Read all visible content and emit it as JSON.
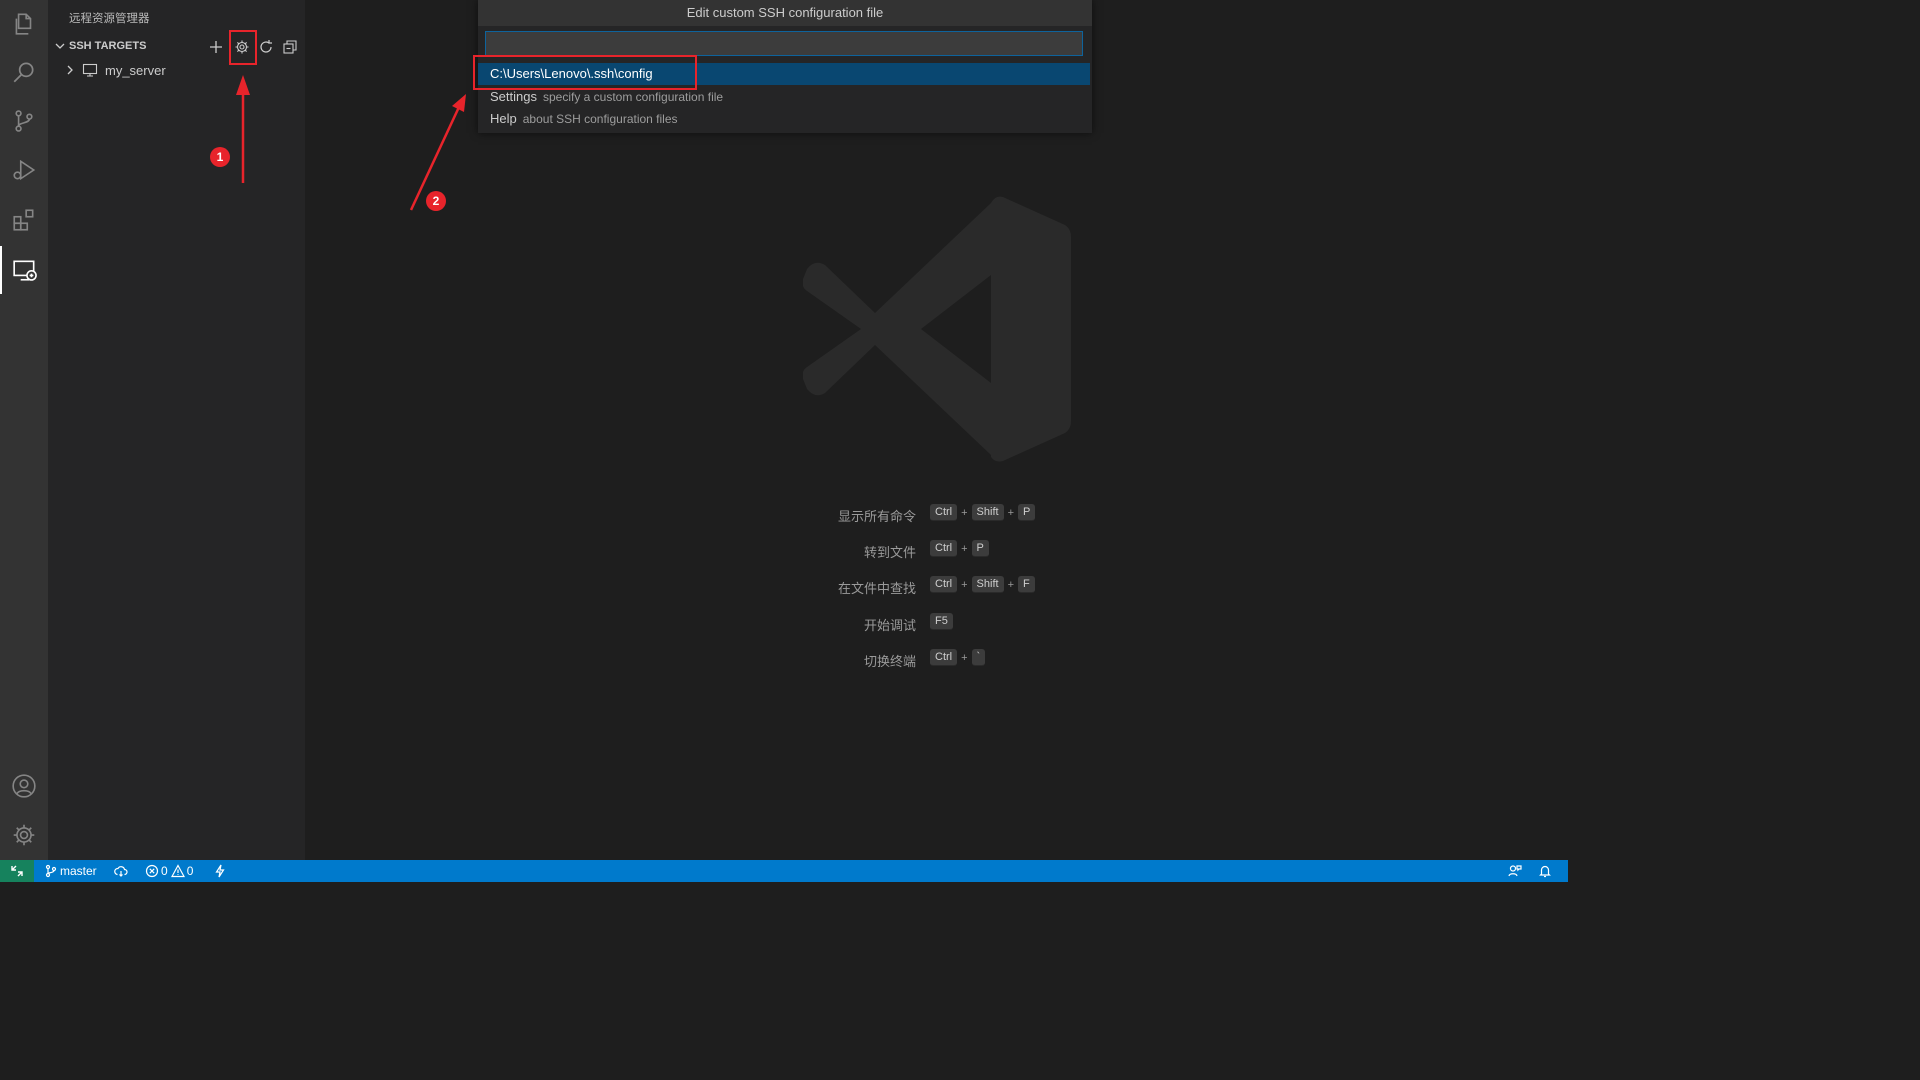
{
  "sidebar": {
    "title": "远程资源管理器",
    "section_title": "SSH TARGETS",
    "targets": [
      {
        "label": "my_server"
      }
    ]
  },
  "quickpick": {
    "title": "Edit custom SSH configuration file",
    "input_value": "",
    "items": [
      {
        "label": "C:\\Users\\Lenovo\\.ssh\\config",
        "description": ""
      },
      {
        "label": "Settings",
        "description": "specify a custom configuration file"
      },
      {
        "label": "Help",
        "description": "about SSH configuration files"
      }
    ]
  },
  "shortcuts": [
    {
      "label": "显示所有命令",
      "keys": [
        "Ctrl",
        "Shift",
        "P"
      ]
    },
    {
      "label": "转到文件",
      "keys": [
        "Ctrl",
        "P"
      ]
    },
    {
      "label": "在文件中查找",
      "keys": [
        "Ctrl",
        "Shift",
        "F"
      ]
    },
    {
      "label": "开始调试",
      "keys": [
        "F5"
      ]
    },
    {
      "label": "切换终端",
      "keys": [
        "Ctrl",
        "`"
      ]
    }
  ],
  "annotations": {
    "badge1": "1",
    "badge2": "2"
  },
  "statusbar": {
    "branch": "master",
    "errors": "0",
    "warnings": "0"
  },
  "colors": {
    "statusbar": "#007acc",
    "remote": "#16825d",
    "selection": "#094771",
    "annotation": "#e8242b"
  }
}
